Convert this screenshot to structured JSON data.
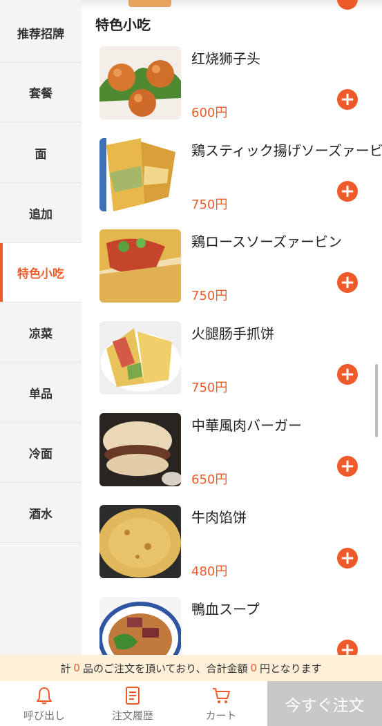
{
  "sidebar": {
    "items": [
      {
        "label": "推荐招牌"
      },
      {
        "label": "套餐"
      },
      {
        "label": "面"
      },
      {
        "label": "追加"
      },
      {
        "label": "特色小吃"
      },
      {
        "label": "凉菜"
      },
      {
        "label": "单品"
      },
      {
        "label": "冷面"
      },
      {
        "label": "酒水"
      }
    ],
    "active": "特色小吃"
  },
  "section": {
    "title": "特色小吃"
  },
  "menu_items": [
    {
      "name": "红烧狮子头",
      "price": "600円"
    },
    {
      "name": "鶏スティック揚げソーズァービン",
      "price": "750円"
    },
    {
      "name": "鶏ロースソーズァービン",
      "price": "750円"
    },
    {
      "name": "火腿肠手抓饼",
      "price": "750円"
    },
    {
      "name": "中華風肉バーガー",
      "price": "650円"
    },
    {
      "name": "牛肉馅饼",
      "price": "480円"
    },
    {
      "name": "鴨血スープ",
      "price": ""
    }
  ],
  "summary": {
    "prefix": "計",
    "count": "0",
    "middle": "品のご注文を頂いており、合計金額",
    "amount": "0",
    "suffix": "円となります"
  },
  "tabbar": {
    "call": "呼び出し",
    "history": "注文履歴",
    "cart": "カート",
    "order_now": "今すぐ注文"
  },
  "colors": {
    "accent": "#ef5a2a",
    "summary_bg": "#fdefd8",
    "order_disabled": "#c8c8c8"
  },
  "icons": [
    "bell-icon",
    "receipt-icon",
    "cart-icon",
    "plus-icon"
  ]
}
